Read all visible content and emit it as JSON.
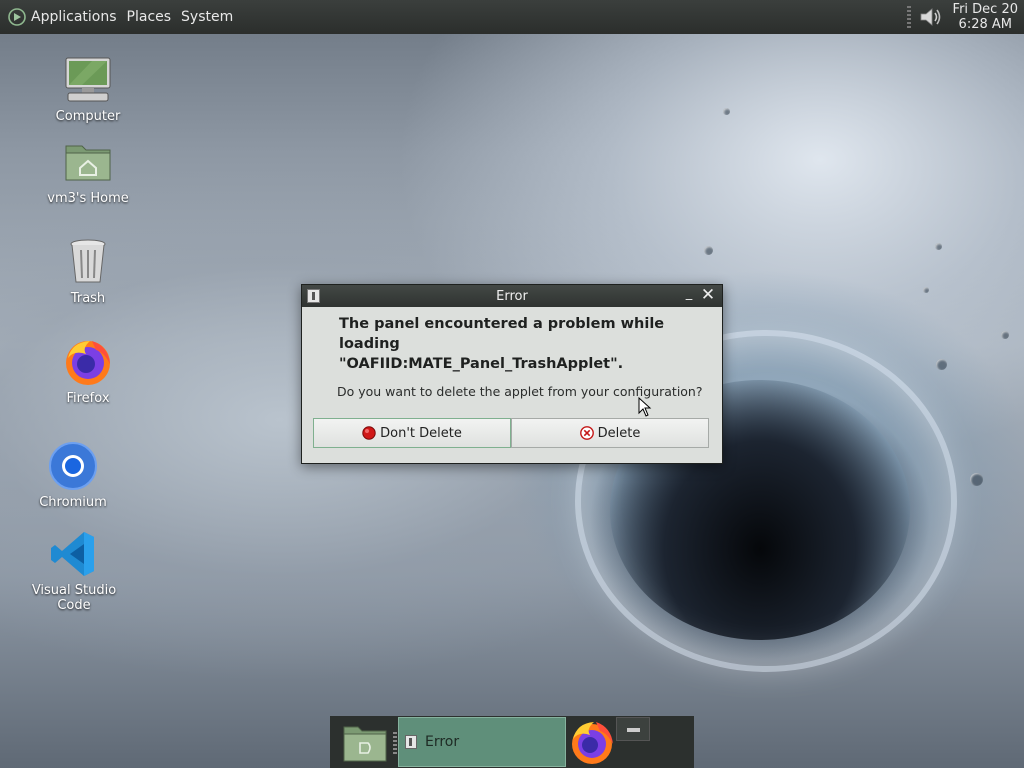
{
  "top_panel": {
    "menus": [
      "Applications",
      "Places",
      "System"
    ],
    "clock": {
      "date": "Fri Dec 20",
      "time": "6:28 AM"
    }
  },
  "desktop_icons": [
    {
      "label": "Computer",
      "icon": "computer-icon"
    },
    {
      "label": "vm3's Home",
      "icon": "home-folder-icon"
    },
    {
      "label": "Trash",
      "icon": "trash-icon"
    },
    {
      "label": "Firefox",
      "icon": "firefox-icon"
    },
    {
      "label": "Chromium",
      "icon": "chromium-icon"
    },
    {
      "label": "Visual Studio Code",
      "icon": "vscode-icon"
    }
  ],
  "dialog": {
    "title": "Error",
    "primary_text": "The panel encountered a problem while loading\n\"OAFIID:MATE_Panel_TrashApplet\".",
    "secondary_text": "Do you want to delete the applet from your configuration?",
    "buttons": {
      "dont_delete": "Don't Delete",
      "delete": "Delete"
    }
  },
  "bottom_panel": {
    "task_label": "Error"
  },
  "colors": {
    "panel": "#2c302e",
    "task_active": "#5f8f7a",
    "dialog_bg": "#dcdfdc"
  }
}
